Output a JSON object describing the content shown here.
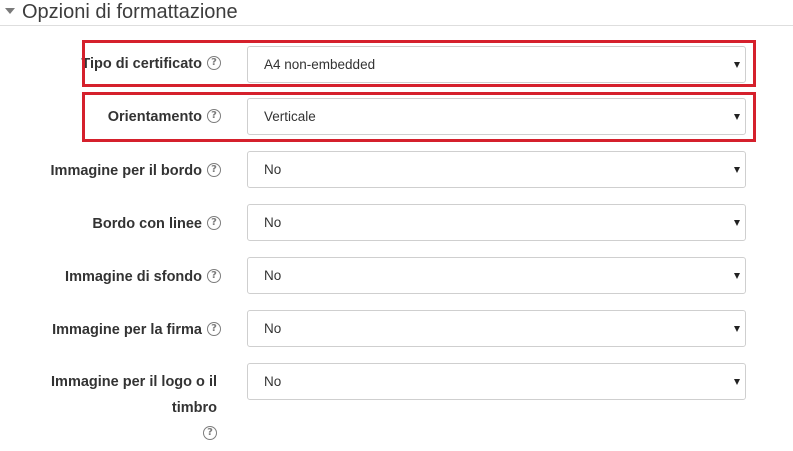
{
  "section": {
    "title": "Opzioni di formattazione"
  },
  "fields": [
    {
      "label": "Tipo di certificato",
      "value": "A4 non-embedded",
      "highlighted": true
    },
    {
      "label": "Orientamento",
      "value": "Verticale",
      "highlighted": true
    },
    {
      "label": "Immagine per il bordo",
      "value": "No",
      "highlighted": false
    },
    {
      "label": "Bordo con linee",
      "value": "No",
      "highlighted": false
    },
    {
      "label": "Immagine di sfondo",
      "value": "No",
      "highlighted": false
    },
    {
      "label": "Immagine per la firma",
      "value": "No",
      "highlighted": false
    },
    {
      "label_line1": "Immagine per il logo o il",
      "label_line2": "timbro",
      "value": "No",
      "highlighted": false
    }
  ],
  "help_icon_glyph": "?",
  "colors": {
    "highlight": "#d5202c",
    "label": "#333333",
    "border": "#cfcfcf"
  }
}
